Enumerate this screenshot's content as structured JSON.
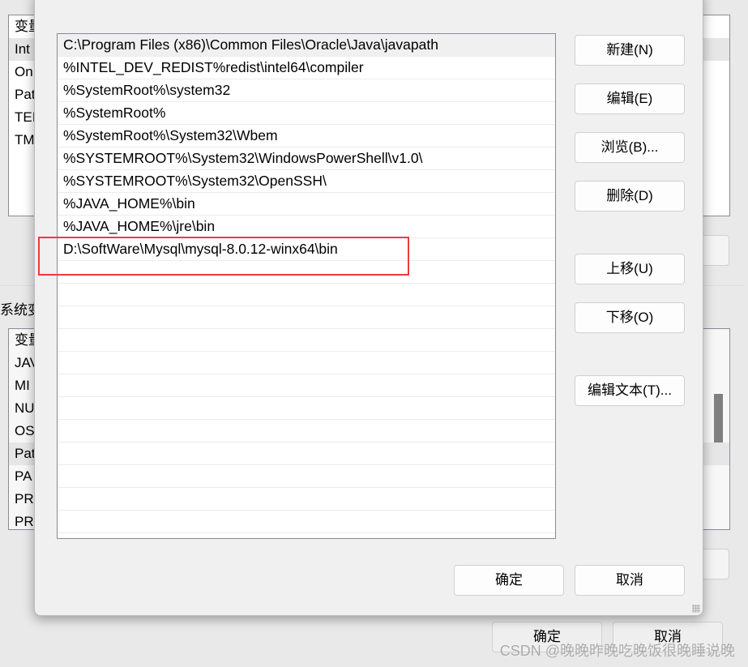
{
  "background_window": {
    "user_vars_header": "变量",
    "user_vars": [
      "Int",
      "On",
      "Pat",
      "TEI",
      "TM"
    ],
    "system_section_label": "系统变",
    "system_vars_header": "变量",
    "system_vars": [
      "JAV",
      "MI",
      "NU",
      "OS",
      "Pat",
      "PA",
      "PR",
      "PR"
    ],
    "ok_label": "确定",
    "cancel_label": "取消"
  },
  "dialog": {
    "paths": [
      "C:\\Program Files (x86)\\Common Files\\Oracle\\Java\\javapath",
      "%INTEL_DEV_REDIST%redist\\intel64\\compiler",
      "%SystemRoot%\\system32",
      "%SystemRoot%",
      "%SystemRoot%\\System32\\Wbem",
      "%SYSTEMROOT%\\System32\\WindowsPowerShell\\v1.0\\",
      "%SYSTEMROOT%\\System32\\OpenSSH\\",
      "%JAVA_HOME%\\bin",
      "%JAVA_HOME%\\jre\\bin",
      "D:\\SoftWare\\Mysql\\mysql-8.0.12-winx64\\bin"
    ],
    "buttons": {
      "new": "新建(N)",
      "edit": "编辑(E)",
      "browse": "浏览(B)...",
      "delete": "删除(D)",
      "move_up": "上移(U)",
      "move_down": "下移(O)",
      "edit_text": "编辑文本(T)..."
    },
    "ok_label": "确定",
    "cancel_label": "取消"
  },
  "highlight_color": "#f03a3a",
  "watermark": "CSDN @晚晚昨晚吃晚饭很晚睡说晚"
}
